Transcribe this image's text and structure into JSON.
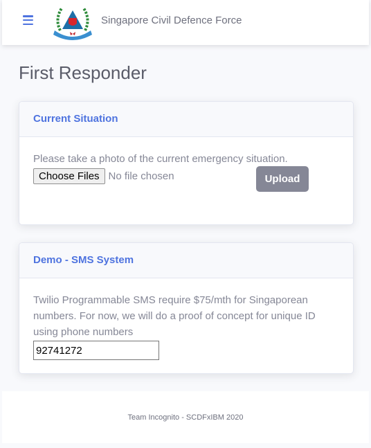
{
  "navbar": {
    "brand": "Singapore Civil Defence Force",
    "menu_icon": "hamburger-icon",
    "logo": "SCDF crest"
  },
  "page": {
    "title": "First Responder"
  },
  "situation_card": {
    "title": "Current Situation",
    "instruction": "Please take a photo of the current emergency situation.",
    "choose_label": "Choose Files",
    "file_status": "No file chosen",
    "upload_label": "Upload"
  },
  "sms_card": {
    "title": "Demo - SMS System",
    "description": "Twilio Programmable SMS require $75/mth for Singaporean numbers. For now, we will do a proof of concept for unique ID using phone numbers",
    "phone_value": "92741272"
  },
  "footer": {
    "text": "Team Incognito - SCDFxIBM 2020"
  },
  "colors": {
    "primary": "#4e73df",
    "secondary": "#858796",
    "background": "#f8f9fc"
  }
}
